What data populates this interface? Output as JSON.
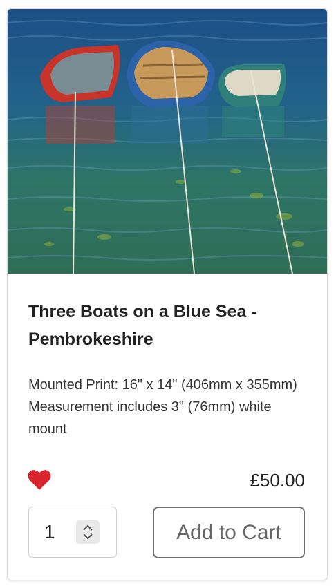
{
  "product": {
    "image_alt": "Three Boats on a Blue Sea - Pembrokeshire",
    "title": "Three Boats on a Blue Sea - Pembrokeshire",
    "description": "Mounted Print: 16\" x 14\" (406mm x 355mm) Measurement includes 3\" (76mm) white mount",
    "price": "£50.00",
    "favorite_color": "#d8242c"
  },
  "cart": {
    "quantity": "1",
    "add_label": "Add to Cart"
  }
}
